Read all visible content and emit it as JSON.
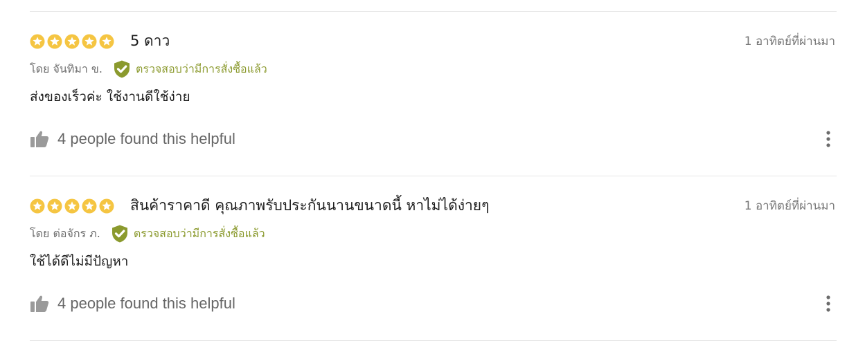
{
  "colors": {
    "star": "#f5c542",
    "verified": "#8b9a2e",
    "muted": "#777777",
    "divider": "#e6e6e6"
  },
  "reviews": [
    {
      "rating": 5,
      "title": "5 ดาว",
      "time": "1 อาทิตย์ที่ผ่านมา",
      "author": "โดย จันทิมา ข.",
      "verified_label": "ตรวจสอบว่ามีการสั่งซื้อแล้ว",
      "body": "ส่งของเร็วค่ะ ใช้งานดีใช้ง่าย",
      "helpful": "4 people found this helpful",
      "icons": {
        "helpful": "thumbs-up-icon",
        "more": "more-vertical-icon",
        "verified": "shield-check-icon",
        "star": "star-icon"
      }
    },
    {
      "rating": 5,
      "title": "สินค้าราคาดี คุณภาพรับประกันนานขนาดนี้ หาไม่ได้ง่ายๆ",
      "time": "1 อาทิตย์ที่ผ่านมา",
      "author": "โดย ต่อจักร ภ.",
      "verified_label": "ตรวจสอบว่ามีการสั่งซื้อแล้ว",
      "body": "ใช้ได้ดีไม่มีปัญหา",
      "helpful": "4 people found this helpful",
      "icons": {
        "helpful": "thumbs-up-icon",
        "more": "more-vertical-icon",
        "verified": "shield-check-icon",
        "star": "star-icon"
      }
    }
  ]
}
